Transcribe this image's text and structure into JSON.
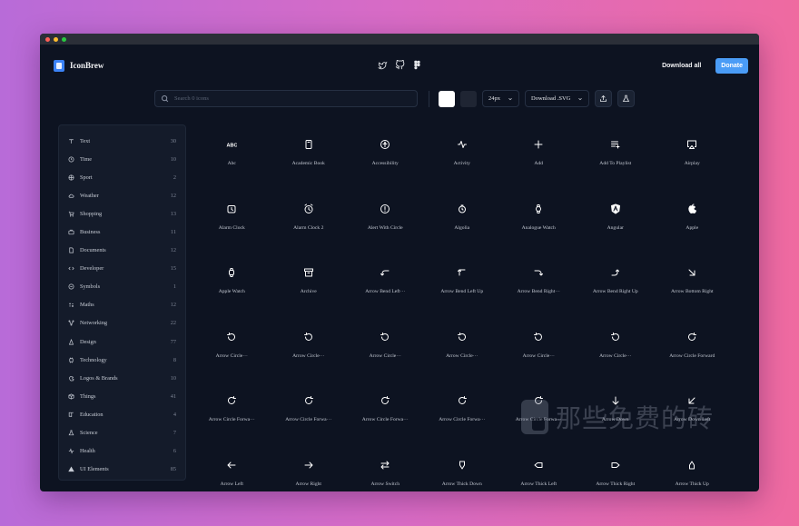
{
  "app": {
    "name": "IconBrew"
  },
  "header": {
    "download_all": "Download all",
    "donate": "Donate"
  },
  "toolbar": {
    "search_placeholder": "Search 0 icons",
    "size": "24px",
    "download_format": "Download .SVG",
    "color_light": "#ffffff",
    "color_dark": "#1f2533"
  },
  "sidebar": {
    "categories": [
      {
        "label": "Text",
        "count": "30",
        "icon": "text-icon"
      },
      {
        "label": "Time",
        "count": "10",
        "icon": "clock-icon"
      },
      {
        "label": "Sport",
        "count": "2",
        "icon": "ball-icon"
      },
      {
        "label": "Weather",
        "count": "12",
        "icon": "cloud-icon"
      },
      {
        "label": "Shopping",
        "count": "13",
        "icon": "cart-icon"
      },
      {
        "label": "Business",
        "count": "11",
        "icon": "briefcase-icon"
      },
      {
        "label": "Documents",
        "count": "12",
        "icon": "document-icon"
      },
      {
        "label": "Developer",
        "count": "15",
        "icon": "code-icon"
      },
      {
        "label": "Symbols",
        "count": "1",
        "icon": "symbol-icon"
      },
      {
        "label": "Maths",
        "count": "12",
        "icon": "math-icon"
      },
      {
        "label": "Networking",
        "count": "22",
        "icon": "network-icon"
      },
      {
        "label": "Design",
        "count": "77",
        "icon": "pen-icon"
      },
      {
        "label": "Technology",
        "count": "8",
        "icon": "chip-icon"
      },
      {
        "label": "Logos & Brands",
        "count": "10",
        "icon": "apple-icon"
      },
      {
        "label": "Things",
        "count": "41",
        "icon": "box-icon"
      },
      {
        "label": "Education",
        "count": "4",
        "icon": "book-icon"
      },
      {
        "label": "Science",
        "count": "7",
        "icon": "flask-icon"
      },
      {
        "label": "Health",
        "count": "6",
        "icon": "pulse-icon"
      },
      {
        "label": "UI Elements",
        "count": "85",
        "icon": "triangle-icon"
      }
    ]
  },
  "icons": [
    {
      "label": "Abc",
      "icon": "abc-icon"
    },
    {
      "label": "Academic Book",
      "icon": "academic-book-icon"
    },
    {
      "label": "Accessibility",
      "icon": "accessibility-icon"
    },
    {
      "label": "Activity",
      "icon": "activity-icon"
    },
    {
      "label": "Add",
      "icon": "add-icon"
    },
    {
      "label": "Add To Playlist",
      "icon": "add-to-playlist-icon"
    },
    {
      "label": "Airplay",
      "icon": "airplay-icon"
    },
    {
      "label": "Alarm Clock",
      "icon": "alarm-clock-icon"
    },
    {
      "label": "Alarm Clock 2",
      "icon": "alarm-clock-2-icon"
    },
    {
      "label": "Alert With Circle",
      "icon": "alert-circle-icon"
    },
    {
      "label": "Algolia",
      "icon": "algolia-icon"
    },
    {
      "label": "Analogue Watch",
      "icon": "analogue-watch-icon"
    },
    {
      "label": "Angular",
      "icon": "angular-icon"
    },
    {
      "label": "Apple",
      "icon": "apple-icon"
    },
    {
      "label": "Apple Watch",
      "icon": "apple-watch-icon"
    },
    {
      "label": "Archive",
      "icon": "archive-icon"
    },
    {
      "label": "Arrow Bend Left···",
      "icon": "arrow-bend-left-icon"
    },
    {
      "label": "Arrow Bend Left Up",
      "icon": "arrow-bend-left-up-icon"
    },
    {
      "label": "Arrow Bend Right···",
      "icon": "arrow-bend-right-icon"
    },
    {
      "label": "Arrow Bend Right Up",
      "icon": "arrow-bend-right-up-icon"
    },
    {
      "label": "Arrow Bottom Right",
      "icon": "arrow-bottom-right-icon"
    },
    {
      "label": "Arrow Circle···",
      "icon": "arrow-circle-icon"
    },
    {
      "label": "Arrow Circle···",
      "icon": "arrow-circle-icon"
    },
    {
      "label": "Arrow Circle···",
      "icon": "arrow-circle-icon"
    },
    {
      "label": "Arrow Circle···",
      "icon": "arrow-circle-icon"
    },
    {
      "label": "Arrow Circle···",
      "icon": "arrow-circle-icon"
    },
    {
      "label": "Arrow Circle···",
      "icon": "arrow-circle-icon"
    },
    {
      "label": "Arrow Circle Forward",
      "icon": "arrow-circle-forward-icon"
    },
    {
      "label": "Arrow Circle Forwa···",
      "icon": "arrow-circle-forward-icon"
    },
    {
      "label": "Arrow Circle Forwa···",
      "icon": "arrow-circle-forward-icon"
    },
    {
      "label": "Arrow Circle Forwa···",
      "icon": "arrow-circle-forward-icon"
    },
    {
      "label": "Arrow Circle Forwa···",
      "icon": "arrow-circle-forward-icon"
    },
    {
      "label": "Arrow Circle Forwa···",
      "icon": "arrow-circle-forward-icon"
    },
    {
      "label": "Arrow Down",
      "icon": "arrow-down-icon"
    },
    {
      "label": "Arrow Down Left",
      "icon": "arrow-down-left-icon"
    },
    {
      "label": "Arrow Left",
      "icon": "arrow-left-icon"
    },
    {
      "label": "Arrow Right",
      "icon": "arrow-right-icon"
    },
    {
      "label": "Arrow Switch",
      "icon": "arrow-switch-icon"
    },
    {
      "label": "Arrow Thick Down",
      "icon": "arrow-thick-down-icon"
    },
    {
      "label": "Arrow Thick Left",
      "icon": "arrow-thick-left-icon"
    },
    {
      "label": "Arrow Thick Right",
      "icon": "arrow-thick-right-icon"
    },
    {
      "label": "Arrow Thick Up",
      "icon": "arrow-thick-up-icon"
    }
  ],
  "watermark": {
    "text": "那些免费的砖"
  }
}
